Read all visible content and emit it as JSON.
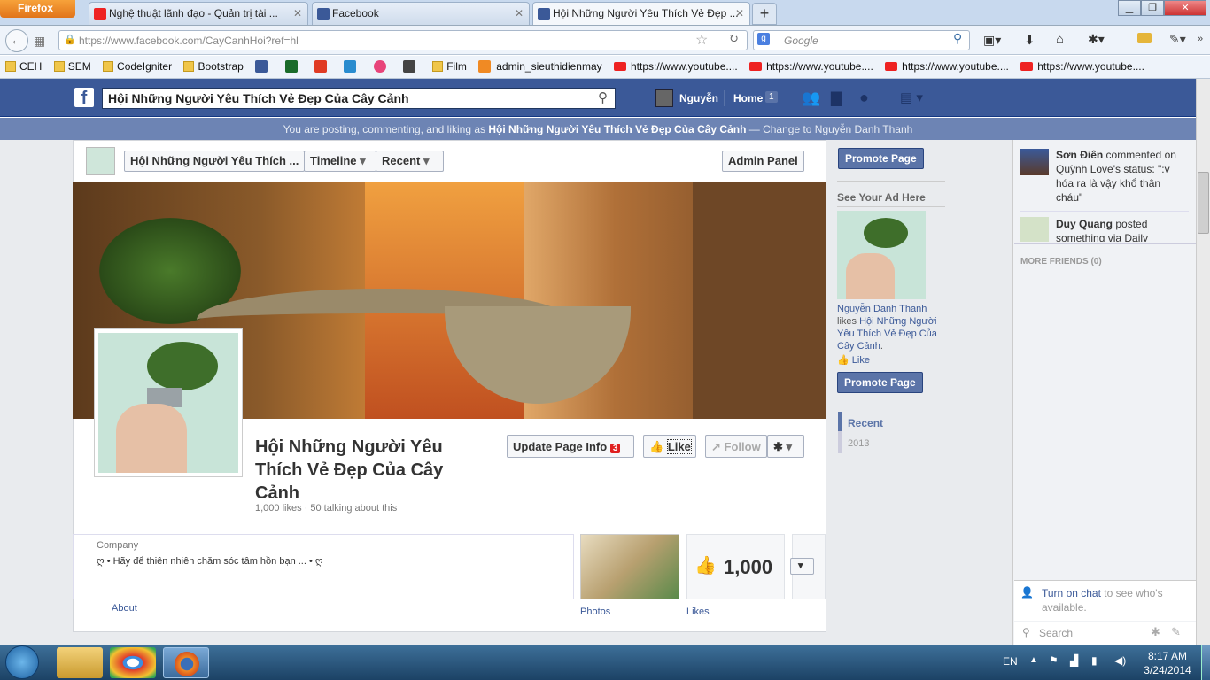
{
  "browser": {
    "menu_label": "Firefox",
    "tabs": [
      {
        "label": "Nghệ thuật lãnh đạo - Quản trị tài ...",
        "favicon": "youtube-icon"
      },
      {
        "label": "Facebook",
        "favicon": "facebook-icon"
      },
      {
        "label": "Hội Những Người Yêu Thích Vẻ Đẹp ...",
        "favicon": "facebook-icon",
        "active": true
      }
    ],
    "new_tab": "+",
    "url": "https://www.facebook.com/CayCanhHoi?ref=hl",
    "search_placeholder": "Google",
    "bookmarks": [
      {
        "label": "CEH",
        "icon": "folder"
      },
      {
        "label": "SEM",
        "icon": "folder"
      },
      {
        "label": "CodeIgniter",
        "icon": "folder"
      },
      {
        "label": "Bootstrap",
        "icon": "folder"
      },
      {
        "label": "",
        "icon": "facebook"
      },
      {
        "label": "",
        "icon": "d-app"
      },
      {
        "label": "",
        "icon": "red-app"
      },
      {
        "label": "",
        "icon": "eye-app"
      },
      {
        "label": "",
        "icon": "pink-app"
      },
      {
        "label": "",
        "icon": "movie-app"
      },
      {
        "label": "Film",
        "icon": "folder"
      },
      {
        "label": "admin_sieuthidienmay",
        "icon": "x-app"
      },
      {
        "label": "https://www.youtube....",
        "icon": "youtube"
      },
      {
        "label": "https://www.youtube....",
        "icon": "youtube"
      },
      {
        "label": "https://www.youtube....",
        "icon": "youtube"
      },
      {
        "label": "https://www.youtube....",
        "icon": "youtube"
      }
    ]
  },
  "fb": {
    "search_value": "Hội Những Người Yêu Thích Vẻ Đẹp Của Cây Cảnh",
    "user_name": "Nguyễn",
    "home_label": "Home",
    "home_count": "1",
    "posting_as_prefix": "You are posting, commenting, and liking as ",
    "posting_as_page": "Hội Những Người Yêu Thích Vẻ Đẹp Của Cây Cảnh",
    "posting_as_suffix": " — Change to Nguyễn Danh Thanh",
    "page_selector": "Hội Những Người Yêu Thích ...",
    "timeline_label": "Timeline",
    "recent_label": "Recent",
    "admin_panel": "Admin Panel",
    "page_name": "Hội Những Người Yêu Thích Vẻ Đẹp Của Cây Cảnh",
    "stats": "1,000 likes · 50 talking about this",
    "update_info": "Update Page Info",
    "update_badge": "3",
    "like_label": "Like",
    "follow_label": "Follow",
    "category": "Company",
    "about_text": "ღ • Hãy để thiên nhiên chăm sóc tâm hồn bạn ... • ღ",
    "about_link": "About",
    "photos_label": "Photos",
    "likes_count": "1,000",
    "likes_label": "Likes"
  },
  "right": {
    "promote_top": "Promote Page",
    "see_ad": "See Your Ad Here",
    "ad_liker": "Nguyễn Danh Thanh",
    "ad_likes_word": "likes",
    "ad_page": "Hội Những Người Yêu Thích Vẻ Đẹp Của Cây Cảnh",
    "ad_like": "Like",
    "promote_bottom": "Promote Page",
    "recent": "Recent",
    "year": "2013"
  },
  "chat": {
    "ticker1_name": "Sơn Điên",
    "ticker1_text": " commented on Quỳnh Love's status: \":v hóa ra là vậy khổ thân cháu\"",
    "ticker2_name": "Duy Quang",
    "ticker2_text": " posted something via Daily",
    "more_friends": "MORE FRIENDS (0)",
    "turn_on": "Turn on chat",
    "turn_on_rest": " to see who's available.",
    "search_placeholder": "Search"
  },
  "taskbar": {
    "lang": "EN",
    "time": "8:17 AM",
    "date": "3/24/2014"
  }
}
